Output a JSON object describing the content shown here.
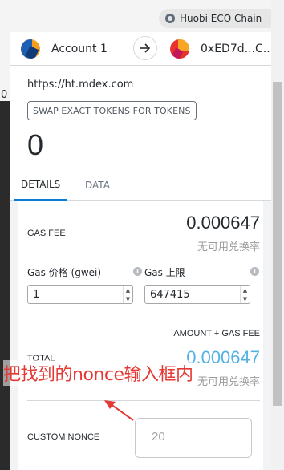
{
  "network": {
    "icon": "network-icon",
    "name": "Huobi ECO Chain"
  },
  "accounts": {
    "from_name": "Account 1",
    "to_address": "0xED7d...C..."
  },
  "origin": "https://ht.mdex.com",
  "method": "SWAP EXACT TOKENS FOR TOKENS",
  "amount": "0",
  "tabs": {
    "details": "DETAILS",
    "data": "DATA"
  },
  "details": {
    "gas_fee_label": "GAS FEE",
    "gas_fee_value": "0.000647",
    "gas_fee_sub": "无可用兑换率",
    "gas_price_label": "Gas 价格 (gwei)",
    "gas_price_value": "1",
    "gas_limit_label": "Gas 上限",
    "gas_limit_value": "647415",
    "amount_gas_label": "AMOUNT + GAS FEE",
    "total_label": "TOTAL",
    "total_value": "0.000647",
    "total_sub": "无可用兑换率",
    "custom_nonce_label": "CUSTOM NONCE",
    "custom_nonce_placeholder": "20"
  },
  "annotation": "把找到的nonce输入框内",
  "colors": {
    "accent": "#037dd6",
    "total": "#52b1e4",
    "annotation": "#e53935"
  }
}
